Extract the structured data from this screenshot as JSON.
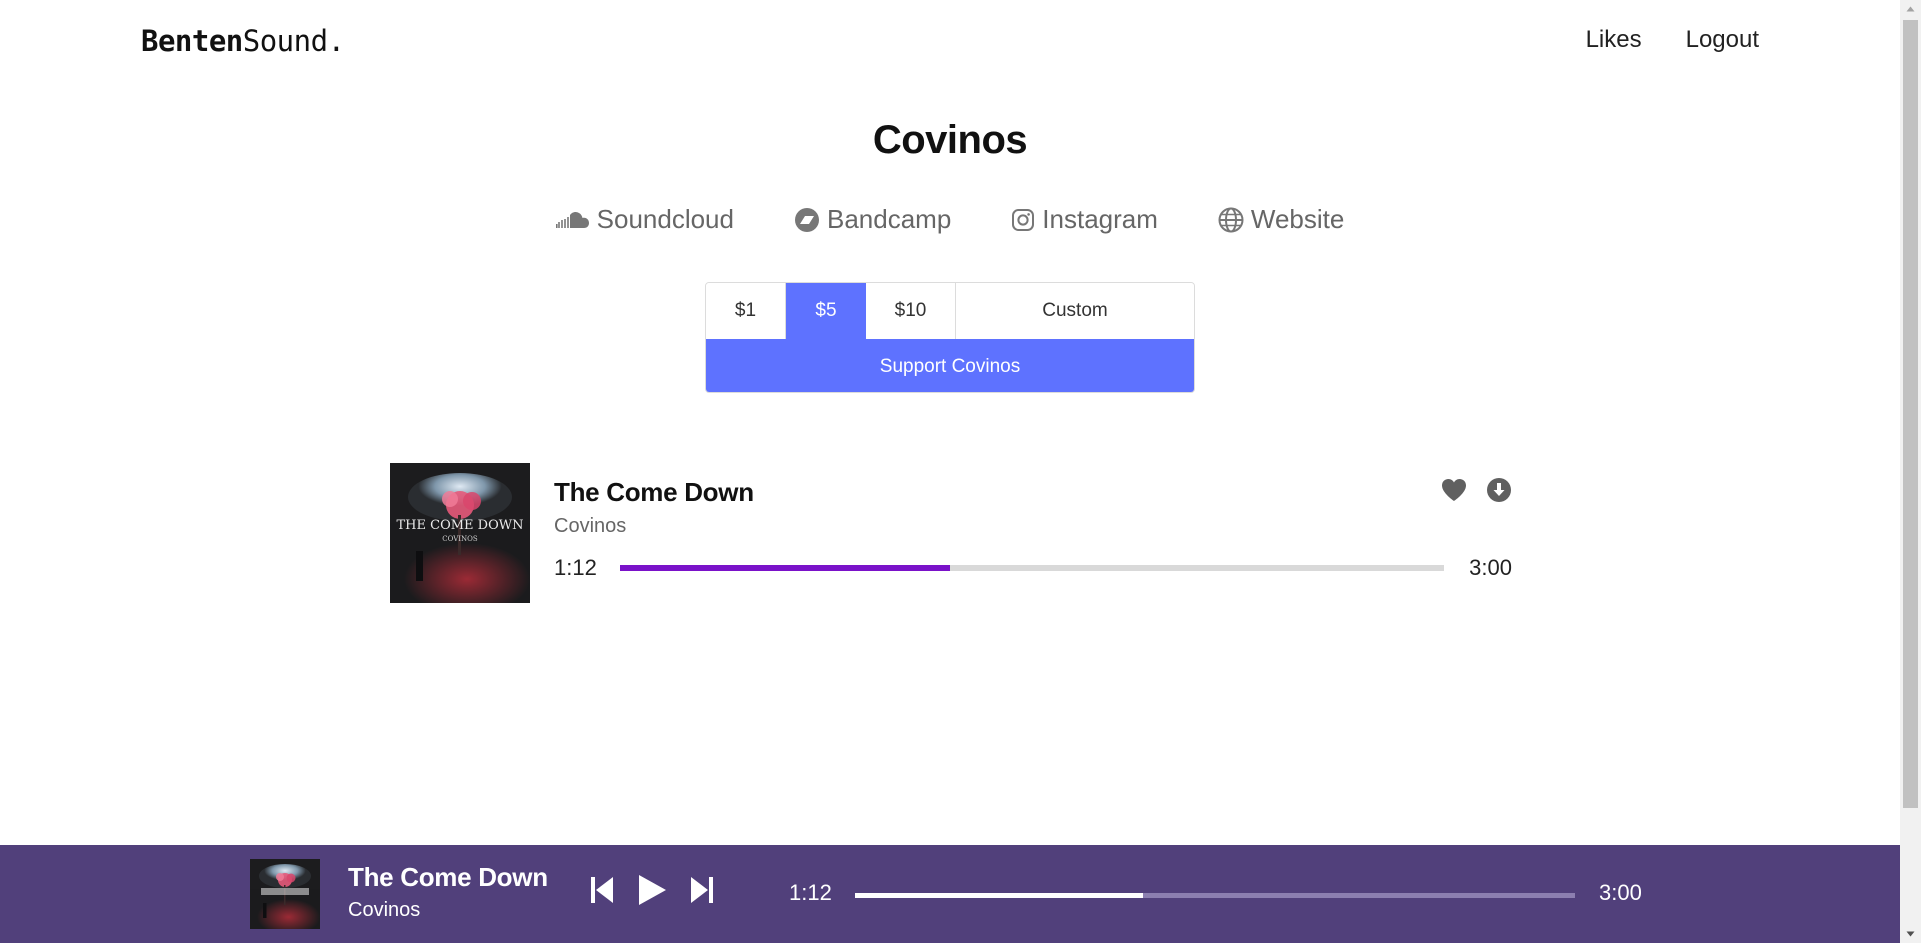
{
  "header": {
    "brand_bold": "Benten",
    "brand_regular": "Sound.",
    "nav": [
      {
        "label": "Likes"
      },
      {
        "label": "Logout"
      }
    ]
  },
  "artist": {
    "name": "Covinos"
  },
  "socials": [
    {
      "label": "Soundcloud",
      "icon": "soundcloud-icon"
    },
    {
      "label": "Bandcamp",
      "icon": "bandcamp-icon"
    },
    {
      "label": "Instagram",
      "icon": "instagram-icon"
    },
    {
      "label": "Website",
      "icon": "globe-icon"
    }
  ],
  "donation": {
    "amounts": [
      "$1",
      "$5",
      "$10"
    ],
    "selected": "$5",
    "custom_label": "Custom",
    "support_label": "Support Covinos",
    "accent_color": "#5e72ff"
  },
  "track": {
    "title": "The Come Down",
    "artist": "Covinos",
    "current_time": "1:12",
    "total_time": "3:00",
    "progress": 0.4,
    "progress_color": "#7a12c9",
    "cover_text": "THE COME DOWN",
    "cover_subtext": "COVINOS"
  },
  "player": {
    "title": "The Come Down",
    "artist": "Covinos",
    "current_time": "1:12",
    "total_time": "3:00",
    "progress": 0.4,
    "background_color": "#51407b"
  }
}
